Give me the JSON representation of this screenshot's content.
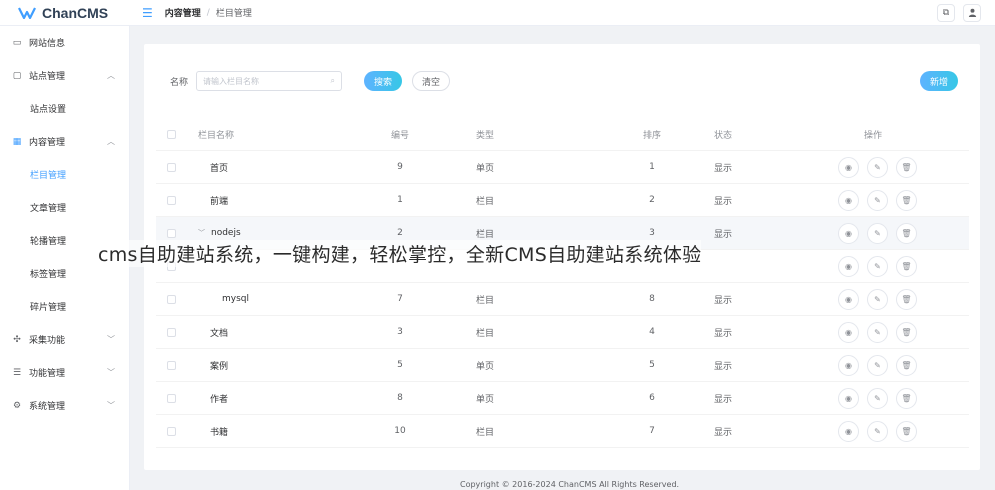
{
  "app": {
    "logo_text": "ChanCMS",
    "brand_color": "#409eff"
  },
  "header": {
    "menu_icon": "hamburger-icon",
    "breadcrumb": [
      "内容管理",
      "栏目管理"
    ],
    "breadcrumb_sep": "/",
    "actions": [
      "external-link-icon",
      "user-icon"
    ]
  },
  "sidebar": {
    "items": [
      {
        "icon": "message-icon",
        "label": "网站信息",
        "type": "item"
      },
      {
        "icon": "monitor-icon",
        "label": "站点管理",
        "type": "group",
        "expanded": true
      },
      {
        "label": "站点设置",
        "type": "sub"
      },
      {
        "icon": "grid-icon",
        "label": "内容管理",
        "type": "group",
        "expanded": true
      },
      {
        "label": "栏目管理",
        "type": "sub",
        "active": true
      },
      {
        "label": "文章管理",
        "type": "sub"
      },
      {
        "label": "轮播管理",
        "type": "sub"
      },
      {
        "label": "标签管理",
        "type": "sub"
      },
      {
        "label": "碎片管理",
        "type": "sub"
      },
      {
        "icon": "collect-icon",
        "label": "采集功能",
        "type": "group",
        "expanded": false
      },
      {
        "icon": "sliders-icon",
        "label": "功能管理",
        "type": "group",
        "expanded": false
      },
      {
        "icon": "gear-icon",
        "label": "系统管理",
        "type": "group",
        "expanded": false
      }
    ]
  },
  "filter": {
    "label": "名称",
    "placeholder": "请输入栏目名称",
    "value": "",
    "search_label": "搜索",
    "clear_label": "清空",
    "add_label": "新增"
  },
  "table": {
    "columns": [
      "栏目名称",
      "编号",
      "类型",
      "排序",
      "状态",
      "操作"
    ],
    "rows": [
      {
        "name": "首页",
        "id": "9",
        "type": "单页",
        "sort": "1",
        "state": "显示",
        "level": 1
      },
      {
        "name": "前端",
        "id": "1",
        "type": "栏目",
        "sort": "2",
        "state": "显示",
        "level": 1
      },
      {
        "name": "nodejs",
        "id": "2",
        "type": "栏目",
        "sort": "3",
        "state": "显示",
        "level": 0,
        "tree": true
      },
      {
        "name": "",
        "id": "",
        "type": "",
        "sort": "",
        "state": "",
        "level": 2
      },
      {
        "name": "mysql",
        "id": "7",
        "type": "栏目",
        "sort": "8",
        "state": "显示",
        "level": 2
      },
      {
        "name": "文档",
        "id": "3",
        "type": "栏目",
        "sort": "4",
        "state": "显示",
        "level": 1
      },
      {
        "name": "案例",
        "id": "5",
        "type": "单页",
        "sort": "5",
        "state": "显示",
        "level": 1
      },
      {
        "name": "作者",
        "id": "8",
        "type": "单页",
        "sort": "6",
        "state": "显示",
        "level": 1
      },
      {
        "name": "书籍",
        "id": "10",
        "type": "栏目",
        "sort": "7",
        "state": "显示",
        "level": 1
      }
    ],
    "row_actions": [
      "eye-icon",
      "edit-icon",
      "trash-icon"
    ]
  },
  "caption": "cms自助建站系统，一键构建，轻松掌控，全新CMS自助建站系统体验",
  "footer": "Copyright © 2016-2024 ChanCMS All Rights Reserved."
}
